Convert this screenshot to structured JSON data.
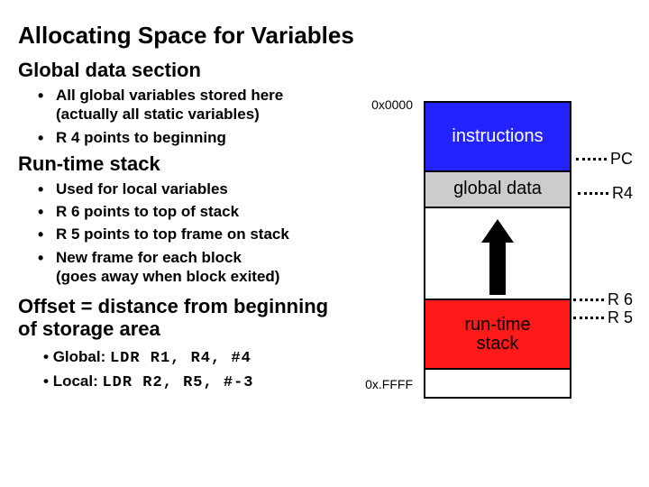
{
  "title": "Allocating Space for Variables",
  "sections": {
    "global": {
      "heading": "Global data section",
      "b1_l1": "All global variables stored here",
      "b1_l2": "(actually all static variables)",
      "b2": "R 4 points to beginning"
    },
    "runtime": {
      "heading": "Run-time stack",
      "b1": "Used for local variables",
      "b2": "R 6 points to top of stack",
      "b3": "R 5 points to top frame on stack",
      "b4_l1": "New frame for each block",
      "b4_l2": "(goes away when block exited)"
    },
    "offset": {
      "heading_l1": "Offset = distance from beginning",
      "heading_l2": "of storage area",
      "ex1_label": "Global: ",
      "ex1_code": "LDR R1, R4, #4",
      "ex2_label": "Local: ",
      "ex2_code": "LDR R2, R5, #-3"
    }
  },
  "diagram": {
    "addr_top": "0x0000",
    "addr_bottom": "0x.FFFF",
    "seg_instructions": "instructions",
    "seg_global": "global data",
    "seg_runtime_l1": "run-time",
    "seg_runtime_l2": "stack",
    "ptr_pc": "PC",
    "ptr_r4": "R4",
    "ptr_r6": "R 6",
    "ptr_r5": "R 5"
  }
}
